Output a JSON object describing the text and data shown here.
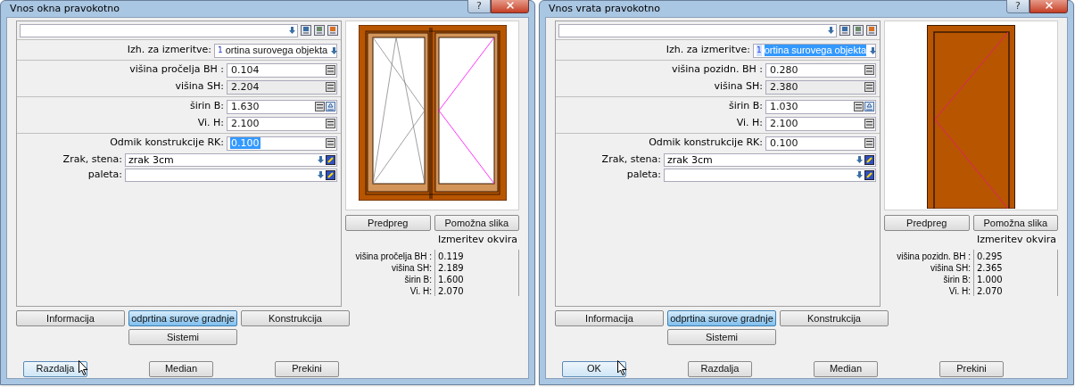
{
  "dialogs": [
    {
      "title": "Vnos okna pravokotno",
      "help": "?",
      "source": {
        "label": "Izh. za izmeritve:",
        "index": "1",
        "value": "ortina surovega objekta",
        "selected": false
      },
      "groups": [
        [
          {
            "label": "višina pročelja BH :",
            "value": "0.104",
            "readonly": false,
            "selected": false,
            "kind": "calc"
          },
          {
            "label": "višina SH:",
            "value": "2.204",
            "readonly": true,
            "selected": false,
            "kind": "calc"
          }
        ],
        [
          {
            "label": "širin B:",
            "value": "1.630",
            "readonly": false,
            "selected": false,
            "kind": "calc_pick"
          },
          {
            "label": "Vi. H:",
            "value": "2.100",
            "readonly": false,
            "selected": false,
            "kind": "calc"
          }
        ],
        [
          {
            "label": "Odmik konstrukcije RK:",
            "value": "0.100",
            "readonly": false,
            "selected": true,
            "kind": "calc"
          }
        ]
      ],
      "combos": [
        {
          "label": "Zrak, stena:",
          "value": "zrak 3cm"
        },
        {
          "label": "paleta:"
        }
      ],
      "preview": {
        "kind": "window"
      },
      "preview_buttons": [
        "Predpreg",
        "Pomožna slika"
      ],
      "measure_title": "Izmeritev okvira",
      "measures": [
        {
          "label": "višina pročelja BH :",
          "value": "0.119"
        },
        {
          "label": "višina SH:",
          "value": "2.189"
        },
        {
          "label": "širin B:",
          "value": "1.600"
        },
        {
          "label": "Vi. H:",
          "value": "2.070"
        }
      ],
      "tabs": [
        {
          "label": "Informacija",
          "selected": false
        },
        {
          "label": "odprtina surove gradnje",
          "selected": true
        },
        {
          "label": "Konstrukcija",
          "selected": false
        },
        {
          "label": "Sistemi",
          "selected": false
        }
      ],
      "buttons": [
        {
          "label": "Razdalja",
          "hovered": true
        },
        {
          "label": "Median",
          "hovered": false
        },
        {
          "label": "Prekini",
          "hovered": false
        }
      ]
    },
    {
      "title": "Vnos vrata pravokotno",
      "help": "?",
      "source": {
        "label": "Izh. za izmeritve:",
        "index": "1",
        "value": "ortina surovega objekta",
        "selected": true
      },
      "groups": [
        [
          {
            "label": "višina pozidn. BH :",
            "value": "0.280",
            "readonly": false,
            "selected": false,
            "kind": "calc"
          },
          {
            "label": "višina SH:",
            "value": "2.380",
            "readonly": true,
            "selected": false,
            "kind": "calc"
          }
        ],
        [
          {
            "label": "širin B:",
            "value": "1.030",
            "readonly": false,
            "selected": false,
            "kind": "calc_pick"
          },
          {
            "label": "Vi. H:",
            "value": "2.100",
            "readonly": false,
            "selected": false,
            "kind": "calc"
          }
        ],
        [
          {
            "label": "Odmik konstrukcije RK:",
            "value": "0.100",
            "readonly": false,
            "selected": false,
            "kind": "calc"
          }
        ]
      ],
      "combos": [
        {
          "label": "Zrak, stena:",
          "value": "zrak 3cm"
        },
        {
          "label": "paleta:"
        }
      ],
      "preview": {
        "kind": "door"
      },
      "preview_buttons": [
        "Predpreg",
        "Pomožna slika"
      ],
      "measure_title": "Izmeritev okvira",
      "measures": [
        {
          "label": "višina pozidn. BH :",
          "value": "0.295"
        },
        {
          "label": "višina SH:",
          "value": "2.365"
        },
        {
          "label": "širin B:",
          "value": "1.000"
        },
        {
          "label": "Vi. H:",
          "value": "2.070"
        }
      ],
      "tabs": [
        {
          "label": "Informacija",
          "selected": false
        },
        {
          "label": "odprtina surove gradnje",
          "selected": true
        },
        {
          "label": "Konstrukcija",
          "selected": false
        },
        {
          "label": "Sistemi",
          "selected": false
        }
      ],
      "buttons": [
        {
          "label": "OK",
          "hovered": true
        },
        {
          "label": "Razdalja",
          "hovered": false
        },
        {
          "label": "Median",
          "hovered": false
        },
        {
          "label": "Prekini",
          "hovered": false
        }
      ]
    }
  ]
}
